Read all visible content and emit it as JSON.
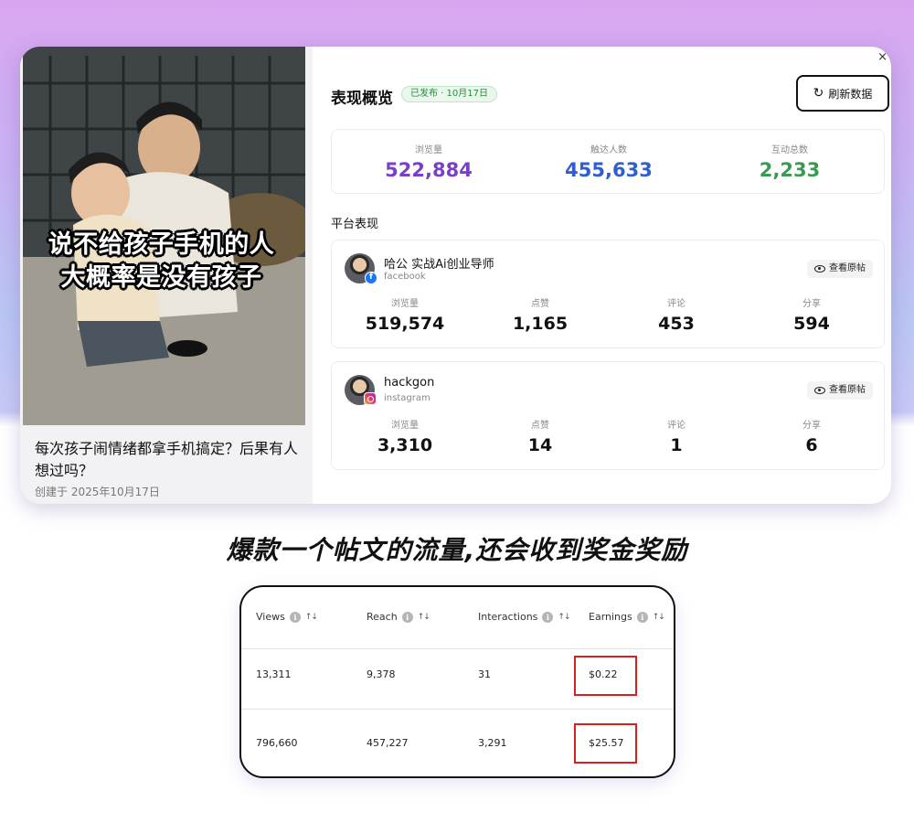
{
  "post": {
    "overlay_line1": "说不给孩子手机的人",
    "overlay_line2": "大概率是没有孩子",
    "title": "每次孩子闹情绪都拿手机搞定？后果有人想过吗？",
    "created": "创建于 2025年10月17日"
  },
  "overview": {
    "title": "表现概览",
    "badge": "已发布 · 10月17日",
    "refresh_label": "刷新数据",
    "close_label": "×",
    "stats": [
      {
        "label": "浏览量",
        "value": "522,884",
        "color": "#7a3fc9"
      },
      {
        "label": "触达人数",
        "value": "455,633",
        "color": "#2f5fcf"
      },
      {
        "label": "互动总数",
        "value": "2,233",
        "color": "#3b9a52"
      }
    ]
  },
  "platforms": {
    "section_title": "平台表现",
    "items": [
      {
        "name": "哈公 实战Ai创业导师",
        "platform": "facebook",
        "view_label": "查看原帖",
        "metrics": [
          {
            "label": "浏览量",
            "value": "519,574"
          },
          {
            "label": "点赞",
            "value": "1,165"
          },
          {
            "label": "评论",
            "value": "453"
          },
          {
            "label": "分享",
            "value": "594"
          }
        ]
      },
      {
        "name": "hackgon",
        "platform": "instagram",
        "view_label": "查看原帖",
        "metrics": [
          {
            "label": "浏览量",
            "value": "3,310"
          },
          {
            "label": "点赞",
            "value": "14"
          },
          {
            "label": "评论",
            "value": "1"
          },
          {
            "label": "分享",
            "value": "6"
          }
        ]
      }
    ]
  },
  "headline": "爆款一个帖文的流量,还会收到奖金奖励",
  "earnings_table": {
    "columns": [
      "Views",
      "Reach",
      "Interactions",
      "Earnings"
    ],
    "rows": [
      [
        "13,311",
        "9,378",
        "31",
        "$0.22"
      ],
      [
        "796,660",
        "457,227",
        "3,291",
        "$25.57"
      ]
    ],
    "highlight_color": "#d42020"
  }
}
